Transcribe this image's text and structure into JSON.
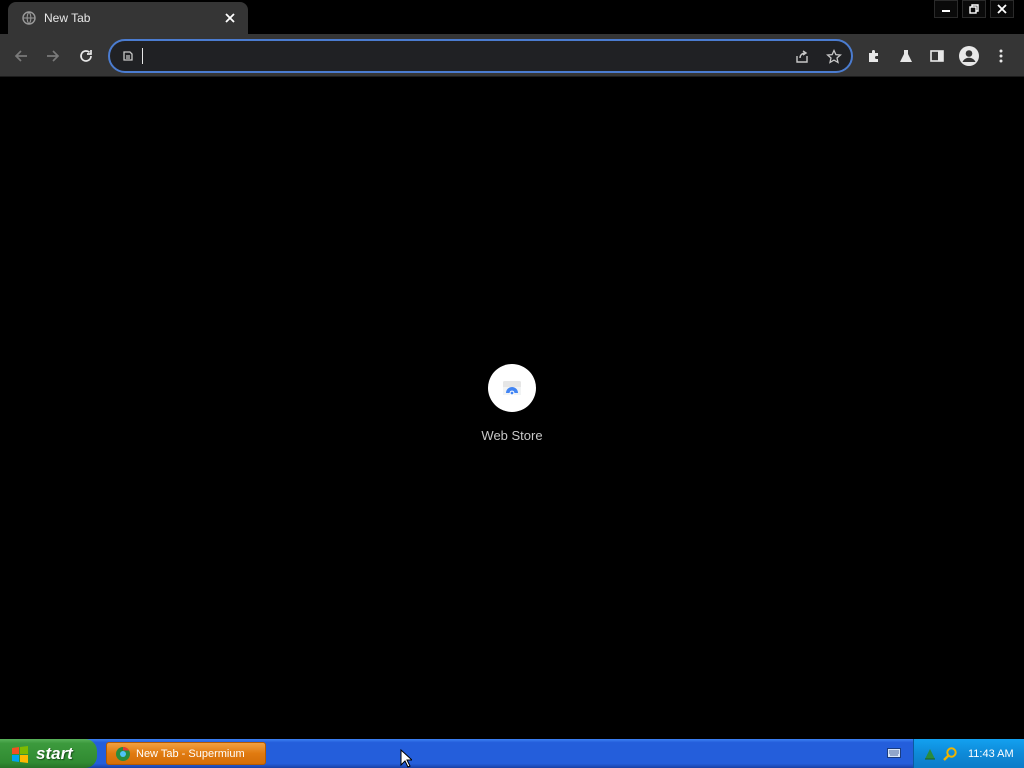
{
  "window": {
    "tab_title": "New Tab",
    "tab_icon": "globe-icon"
  },
  "toolbar": {
    "omnibox_value": "",
    "omnibox_placeholder": ""
  },
  "content": {
    "shortcuts": [
      {
        "label": "Web Store",
        "icon": "web-store-icon"
      }
    ]
  },
  "taskbar": {
    "start_label": "start",
    "task_label": "New Tab - Supermium",
    "clock": "11:43 AM"
  },
  "colors": {
    "omnibox_border": "#4b7cd0",
    "taskbar_blue": "#245edb",
    "start_green": "#318b32",
    "active_task_orange": "#e07a10"
  }
}
